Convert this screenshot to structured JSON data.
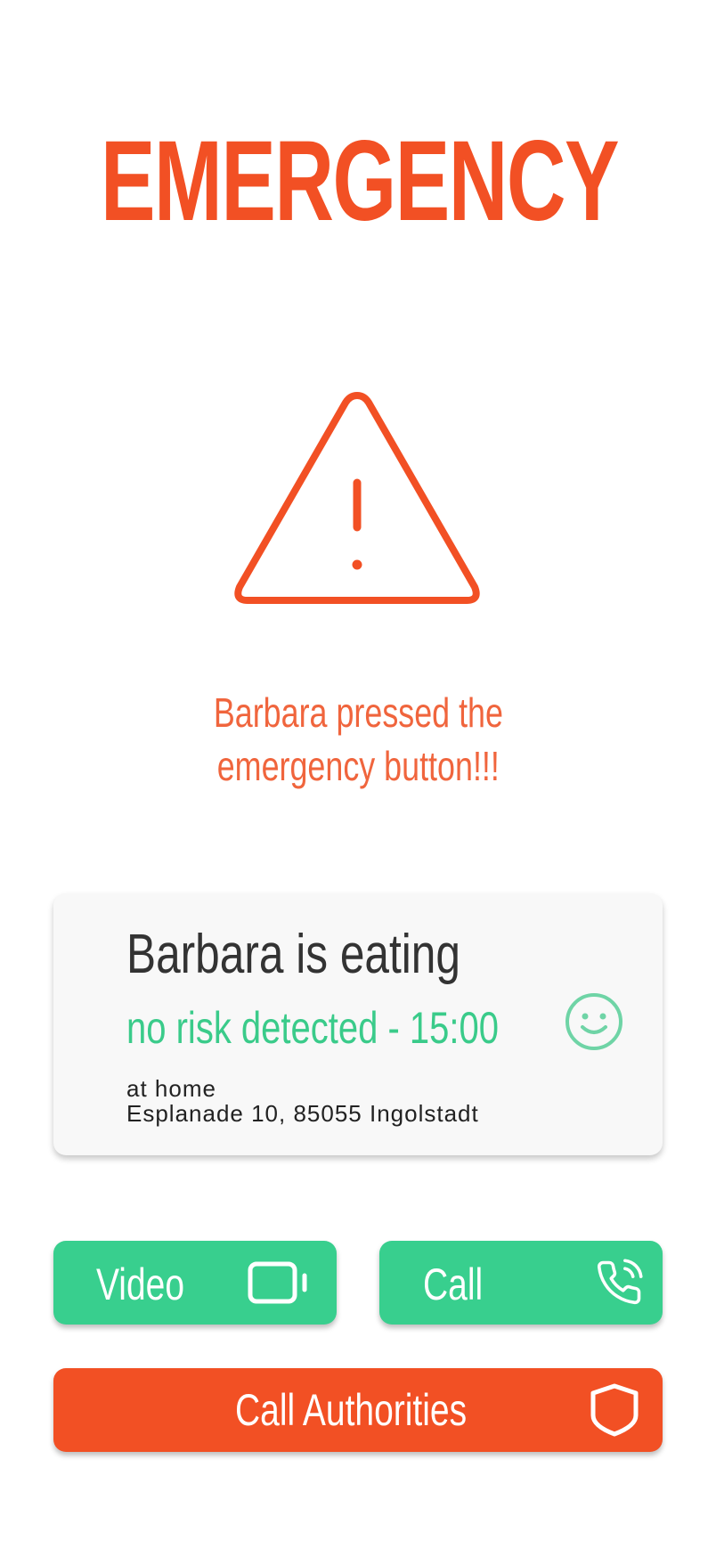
{
  "header": {
    "title": "EMERGENCY"
  },
  "alert": {
    "icon": "warning-triangle-icon",
    "message_line1": "Barbara pressed the",
    "message_line2": "emergency button!!!"
  },
  "status_card": {
    "title": "Barbara is eating",
    "status": "no risk detected - 15:00",
    "location_label": "at home",
    "address": "Esplanade 10, 85055 Ingolstadt",
    "mood_icon": "smiley-icon"
  },
  "actions": {
    "video_label": "Video",
    "video_icon": "video-camera-icon",
    "call_label": "Call",
    "call_icon": "phone-call-icon",
    "authorities_label": "Call Authorities",
    "authorities_icon": "shield-icon"
  },
  "colors": {
    "alert": "#F25024",
    "success": "#38CF8E",
    "text_dark": "#333333",
    "card_bg": "#f8f8f8"
  }
}
